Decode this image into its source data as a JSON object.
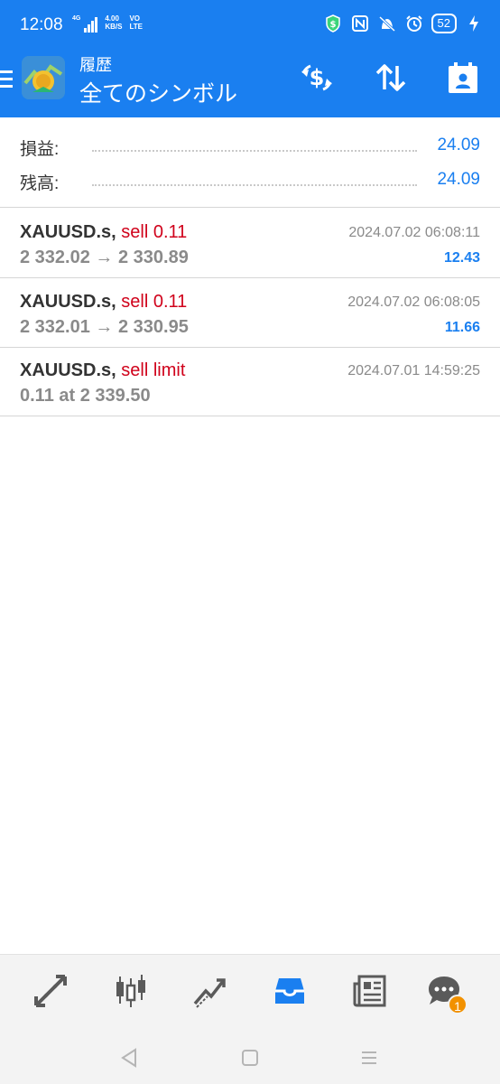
{
  "status_bar": {
    "time": "12:08",
    "network_type": "4G",
    "speed_value": "4.00",
    "speed_unit": "KB/S",
    "volte_top": "VO",
    "volte_bottom": "LTE",
    "battery": "52"
  },
  "header": {
    "subtitle": "履歴",
    "title": "全てのシンボル",
    "accent_color": "#1a7ff0"
  },
  "summary": {
    "profit_label": "損益:",
    "profit_value": "24.09",
    "balance_label": "残高:",
    "balance_value": "24.09"
  },
  "deals": [
    {
      "symbol": "XAUUSD.s,",
      "side": "sell 0.11",
      "time": "2024.07.02 06:08:11",
      "price": "2 332.02 → 2 330.89",
      "profit": "12.43"
    },
    {
      "symbol": "XAUUSD.s,",
      "side": "sell 0.11",
      "time": "2024.07.02 06:08:05",
      "price": "2 332.01 → 2 330.95",
      "profit": "11.66"
    },
    {
      "symbol": "XAUUSD.s,",
      "side": "sell limit",
      "time": "2024.07.01 14:59:25",
      "price": "0.11 at 2 339.50",
      "profit": ""
    }
  ],
  "bottom_nav": {
    "items": [
      "quotes-icon",
      "chart-icon",
      "trade-icon",
      "history-icon",
      "news-icon",
      "chat-icon"
    ],
    "active": "history-icon",
    "chat_badge": "1"
  },
  "colors": {
    "sell": "#d0021b",
    "profit": "#1a7ff0",
    "muted": "#8a8a8a"
  }
}
